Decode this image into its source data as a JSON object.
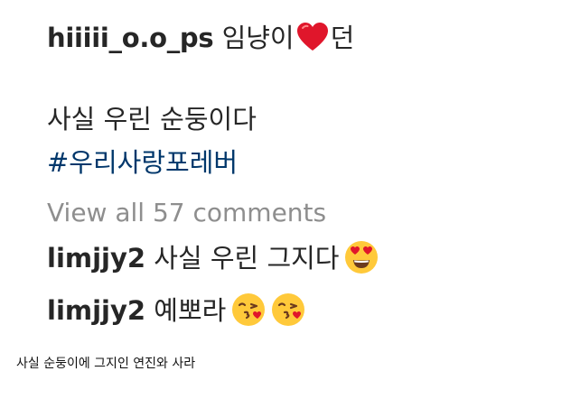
{
  "post": {
    "caption_username": "hiiiii_o.o_ps",
    "caption_text_before": "임냥이",
    "caption_text_after": "던",
    "caption_body": "사실 우린 순둥이다",
    "hashtag": "#우리사랑포레버",
    "view_all_comments": "View all 57 comments"
  },
  "comments": [
    {
      "username": "limjjy2",
      "text": "사실 우린 그지다",
      "emojis": [
        "heart-eyes-emoji"
      ]
    },
    {
      "username": "limjjy2",
      "text": "예뽀라",
      "emojis": [
        "kissing-heart-emoji",
        "kissing-heart-emoji"
      ]
    }
  ],
  "footnote": "사실 순둥이에 그지인 연진와 사라",
  "colors": {
    "text": "#262626",
    "hashtag": "#00376b",
    "muted": "#8e8e8e",
    "heart": "#e0162b",
    "emoji_face": "#ffc93a"
  }
}
